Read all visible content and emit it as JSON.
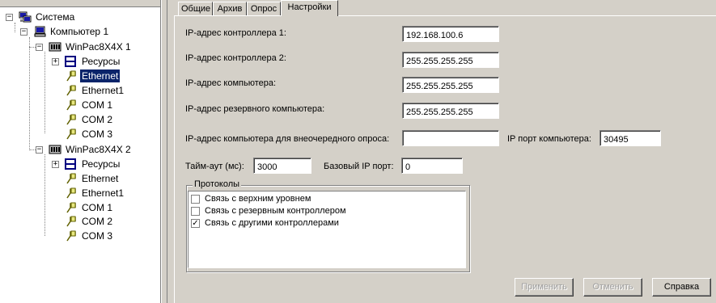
{
  "tree": {
    "root": "Система",
    "computer": "Компьютер 1",
    "controllers": [
      {
        "name": "WinPac8X4X 1",
        "items": [
          "Ресурсы",
          "Ethernet",
          "Ethernet1",
          "COM 1",
          "COM 2",
          "COM 3"
        ]
      },
      {
        "name": "WinPac8X4X 2",
        "items": [
          "Ресурсы",
          "Ethernet",
          "Ethernet1",
          "COM 1",
          "COM 2",
          "COM 3"
        ]
      }
    ],
    "selected": "WinPac8X4X 1 / Ethernet"
  },
  "tabs": [
    "Общие",
    "Архив",
    "Опрос",
    "Настройки"
  ],
  "active_tab": "Настройки",
  "form": {
    "ip1_label": "IP-адрес контроллера 1:",
    "ip1_value": "192.168.100.6",
    "ip2_label": "IP-адрес контроллера 2:",
    "ip2_value": "255.255.255.255",
    "pc_ip_label": "IP-адрес  компьютера:",
    "pc_ip_value": "255.255.255.255",
    "backup_ip_label": "IP-адрес резервного  компьютера:",
    "backup_ip_value": "255.255.255.255",
    "extra_ip_label": "IP-адрес  компьютера для внеочередного опроса:",
    "extra_ip_value": "",
    "pc_port_label": "IP порт компьютера:",
    "pc_port_value": "30495",
    "timeout_label": "Тайм-аут (мс):",
    "timeout_value": "3000",
    "base_port_label": "Базовый IP порт:",
    "base_port_value": "0"
  },
  "protocols": {
    "title": "Протоколы",
    "items": [
      {
        "label": "Связь с верхним уровнем",
        "checked": false
      },
      {
        "label": "Связь с резервным контроллером",
        "checked": false
      },
      {
        "label": "Связь с другими контроллерами",
        "checked": true
      }
    ]
  },
  "buttons": {
    "apply": "Применить",
    "cancel": "Отменить",
    "help": "Справка"
  },
  "colors": {
    "selection": "#0a246a",
    "face": "#d4d0c8"
  }
}
